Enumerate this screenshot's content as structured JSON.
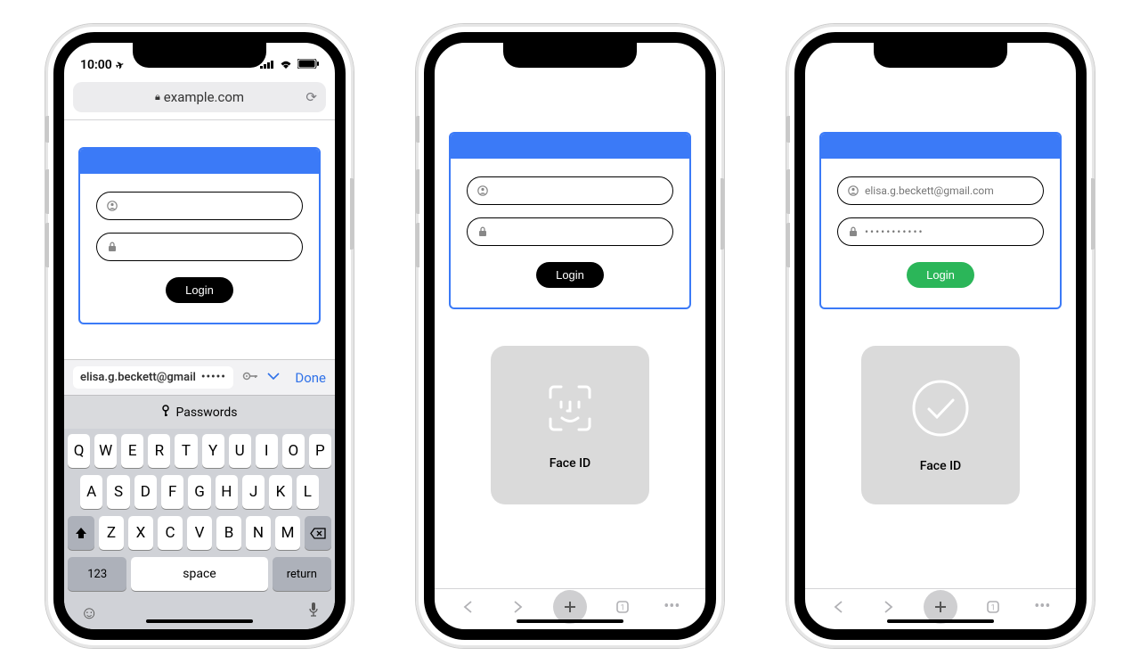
{
  "status": {
    "time": "10:00",
    "location_glyph": "➤"
  },
  "url": "example.com",
  "login": {
    "login_label": "Login",
    "filled_email": "elisa.g.beckett@gmail.com",
    "filled_password": "•••••••••••"
  },
  "faceid": {
    "label": "Face ID"
  },
  "autofill": {
    "suggestion_email": "elisa.g.beckett@gmail",
    "suggestion_pw": "•••••",
    "done": "Done",
    "passwords": "Passwords"
  },
  "keyboard": {
    "row1": [
      "Q",
      "W",
      "E",
      "R",
      "T",
      "Y",
      "U",
      "I",
      "O",
      "P"
    ],
    "row2": [
      "A",
      "S",
      "D",
      "F",
      "G",
      "H",
      "J",
      "K",
      "L"
    ],
    "row3": [
      "Z",
      "X",
      "C",
      "V",
      "B",
      "N",
      "M"
    ],
    "num": "123",
    "space": "space",
    "return": "return"
  }
}
